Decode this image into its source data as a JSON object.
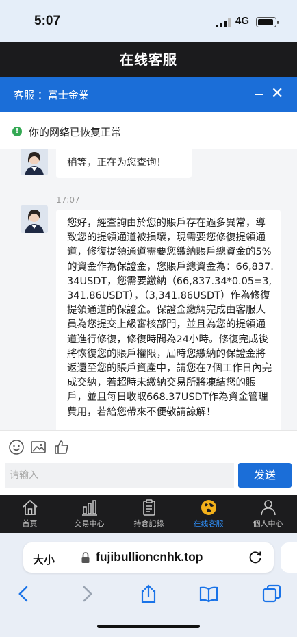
{
  "status_bar": {
    "time": "5:07",
    "network": "4G",
    "battery_level": 0.9
  },
  "title_bar": {
    "title": "在线客服"
  },
  "chat_header": {
    "agent_label": "客服 ：富士金業",
    "minimize_icon": "minus-icon",
    "close_icon": "close-icon"
  },
  "network_banner": {
    "icon": "exclamation-icon",
    "text": "你的网络已恢复正常",
    "color": "#34a853"
  },
  "messages": [
    {
      "text": "稍等，正在为您查询！"
    },
    {
      "time": "17:07",
      "text": "您好，經查詢由於您的賬戶存在過多異常，導致您的提領通道被損壞，現需要您修復提領通道，修復提領通道需要您繳納賬戶總資金的5%的資金作為保證金，您賬戶總資金為：66,837.34USDT，您需要繳納（66,837.34*0.05=3,341.86USDT），（3,341.86USDT）作為修復提領通道的保證金。保證金繳納完成由客服人員為您提交上級審核部門，並且為您的提領通道進行修復，修復時間為24小時。修復完成後將恢復您的賬戶權限，屆時您繳納的保證金將返還至您的賬戶資產中，請您在7個工作日內完成交納，若超時未繳納交易所將凍結您的賬戶，並且每日收取668.37USDT作為資金管理費用，若給您帶來不便敬請諒解！"
    }
  ],
  "toolbar": {
    "icons": [
      "smiley-icon",
      "image-icon",
      "thumbs-up-icon"
    ]
  },
  "input": {
    "placeholder": "请输入",
    "send_label": "发送"
  },
  "bottom_nav": {
    "items": [
      {
        "label": "首頁",
        "icon": "home-icon"
      },
      {
        "label": "交易中心",
        "icon": "bar-chart-icon"
      },
      {
        "label": "持倉記錄",
        "icon": "clipboard-icon"
      },
      {
        "label": "在线客服",
        "icon": "globe-icon",
        "active": true
      },
      {
        "label": "個人中心",
        "icon": "person-icon"
      }
    ]
  },
  "browser": {
    "text_size_label": "大小",
    "url": "fujibullioncnhk.top",
    "icons": [
      "lock-icon",
      "reload-icon",
      "back-icon",
      "forward-icon",
      "share-icon",
      "bookmarks-icon",
      "tabs-icon"
    ]
  },
  "colors": {
    "accent": "#1b6ed8",
    "title_bar": "#1b1b1d",
    "nav_active": "#2f8df5",
    "nav_bg": "#1c1c1e"
  }
}
